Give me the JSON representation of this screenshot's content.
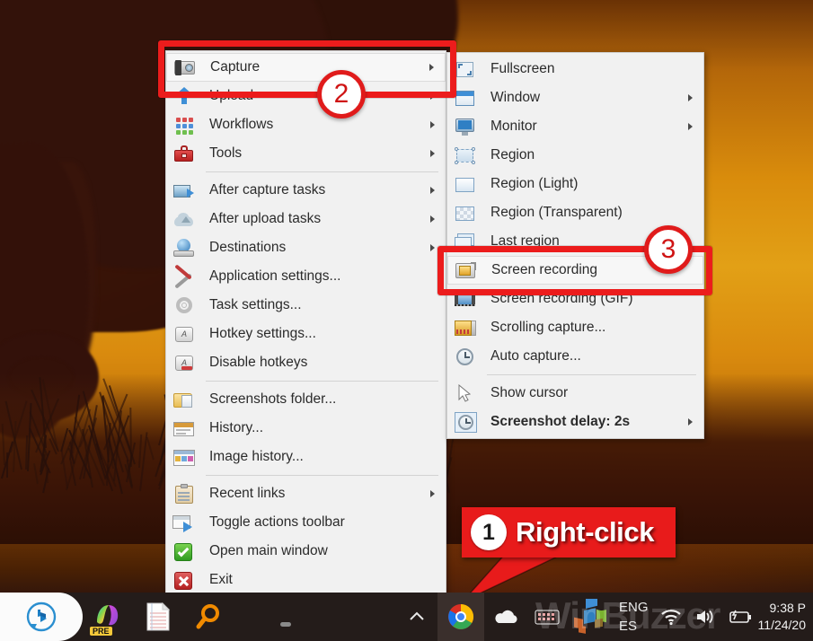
{
  "wallpaper": {
    "description": "elephant-silhouette-sunset"
  },
  "main_menu": {
    "items": [
      {
        "label": "Capture",
        "icon": "camera-icon",
        "submenu": true,
        "highlighted": true
      },
      {
        "label": "Upload",
        "icon": "upload-arrow-icon",
        "submenu": true
      },
      {
        "label": "Workflows",
        "icon": "workflows-grid-icon",
        "submenu": true
      },
      {
        "label": "Tools",
        "icon": "toolbox-icon",
        "submenu": true
      },
      {
        "separator": true
      },
      {
        "label": "After capture tasks",
        "icon": "after-capture-icon",
        "submenu": true
      },
      {
        "label": "After upload tasks",
        "icon": "after-upload-icon",
        "submenu": true
      },
      {
        "label": "Destinations",
        "icon": "destinations-globe-icon",
        "submenu": true
      },
      {
        "label": "Application settings...",
        "icon": "tools-wrench-icon",
        "submenu": false
      },
      {
        "label": "Task settings...",
        "icon": "gear-icon",
        "submenu": false
      },
      {
        "label": "Hotkey settings...",
        "icon": "keyboard-key-icon",
        "submenu": false
      },
      {
        "label": "Disable hotkeys",
        "icon": "keyboard-key-disabled-icon",
        "submenu": false
      },
      {
        "separator": true
      },
      {
        "label": "Screenshots folder...",
        "icon": "folder-icon",
        "submenu": false
      },
      {
        "label": "History...",
        "icon": "history-icon",
        "submenu": false
      },
      {
        "label": "Image history...",
        "icon": "image-history-icon",
        "submenu": false
      },
      {
        "separator": true
      },
      {
        "label": "Recent links",
        "icon": "clipboard-icon",
        "submenu": true
      },
      {
        "label": "Toggle actions toolbar",
        "icon": "toolbar-icon",
        "submenu": false
      },
      {
        "label": "Open main window",
        "icon": "green-check-icon",
        "submenu": false
      },
      {
        "label": "Exit",
        "icon": "red-x-icon",
        "submenu": false
      }
    ]
  },
  "capture_submenu": {
    "items": [
      {
        "label": "Fullscreen",
        "icon": "fullscreen-icon",
        "submenu": false
      },
      {
        "label": "Window",
        "icon": "window-icon",
        "submenu": true
      },
      {
        "label": "Monitor",
        "icon": "monitor-icon",
        "submenu": true
      },
      {
        "label": "Region",
        "icon": "region-icon",
        "submenu": false
      },
      {
        "label": "Region (Light)",
        "icon": "region-light-icon",
        "submenu": false
      },
      {
        "label": "Region (Transparent)",
        "icon": "region-transparent-icon",
        "submenu": false
      },
      {
        "label": "Last region",
        "icon": "last-region-icon",
        "submenu": false
      },
      {
        "label": "Screen recording",
        "icon": "screen-recording-icon",
        "submenu": false,
        "highlighted": true
      },
      {
        "label": "Screen recording (GIF)",
        "icon": "screen-recording-gif-icon",
        "submenu": false
      },
      {
        "label": "Scrolling capture...",
        "icon": "scrolling-capture-icon",
        "submenu": false
      },
      {
        "label": "Auto capture...",
        "icon": "clock-icon",
        "submenu": false
      },
      {
        "separator": true
      },
      {
        "label": "Show cursor",
        "icon": "cursor-icon",
        "submenu": false
      },
      {
        "label": "Screenshot delay: 2s",
        "icon": "delay-clock-icon",
        "submenu": true,
        "bold": true
      }
    ]
  },
  "annotations": {
    "badge_2": "2",
    "badge_3": "3",
    "callout": {
      "number": "1",
      "text": "Right-click"
    },
    "box_color": "#ec1c1c"
  },
  "taskbar": {
    "icons": [
      {
        "name": "bing-chat-icon"
      },
      {
        "name": "copilot-pre-icon",
        "badge": "PRE"
      },
      {
        "name": "notepad-icon"
      },
      {
        "name": "search-magnifier-icon"
      }
    ],
    "tray": {
      "chevron": "show-hidden-icons-icon",
      "icons": [
        {
          "name": "chrome-icon"
        },
        {
          "name": "onedrive-icon"
        },
        {
          "name": "keyboard-tray-icon"
        },
        {
          "name": "sharex-tray-icon"
        },
        {
          "name": "wifi-icon"
        },
        {
          "name": "volume-icon"
        },
        {
          "name": "battery-charging-icon"
        }
      ],
      "language_primary": "ENG",
      "language_secondary": "ES"
    },
    "clock": {
      "time": "9:38 P",
      "date": "11/24/20"
    },
    "watermark": "WinBuzzer"
  }
}
